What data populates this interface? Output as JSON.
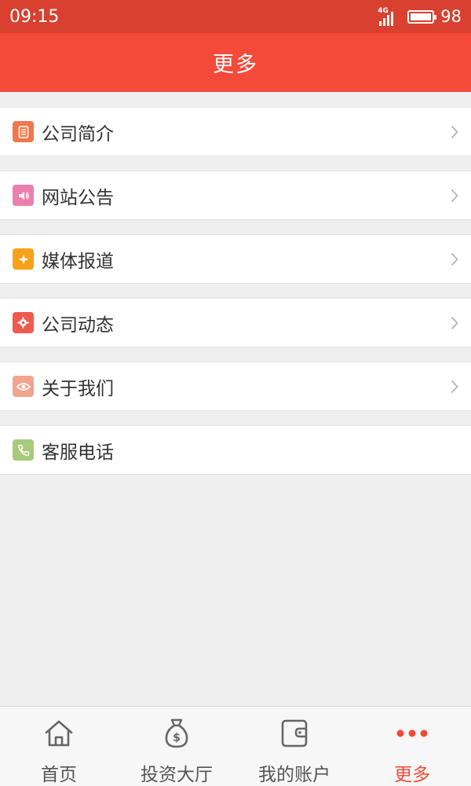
{
  "status_bar": {
    "time": "09:15",
    "network": "4G",
    "battery": "98",
    "battery_level": 0.98
  },
  "header": {
    "title": "更多"
  },
  "menu": {
    "items": [
      {
        "label": "公司简介",
        "icon": "document-icon",
        "color": "#f0774c"
      },
      {
        "label": "网站公告",
        "icon": "speaker-icon",
        "color": "#ec7fad"
      },
      {
        "label": "媒体报道",
        "icon": "sparkle-icon",
        "color": "#f7a21b"
      },
      {
        "label": "公司动态",
        "icon": "gear-icon",
        "color": "#ef5a4c"
      },
      {
        "label": "关于我们",
        "icon": "eye-icon",
        "color": "#f3a48c"
      },
      {
        "label": "客服电话",
        "icon": "phone-icon",
        "color": "#a7cb7a"
      }
    ]
  },
  "tab_bar": {
    "tabs": [
      {
        "label": "首页",
        "icon": "home-icon"
      },
      {
        "label": "投资大厅",
        "icon": "money-bag-icon"
      },
      {
        "label": "我的账户",
        "icon": "wallet-icon"
      },
      {
        "label": "更多",
        "icon": "more-dots-icon"
      }
    ],
    "active_index": 3
  },
  "colors": {
    "status_bar": "#d9402f",
    "header": "#f34a3a",
    "accent": "#f14a37",
    "background": "#efefef"
  }
}
